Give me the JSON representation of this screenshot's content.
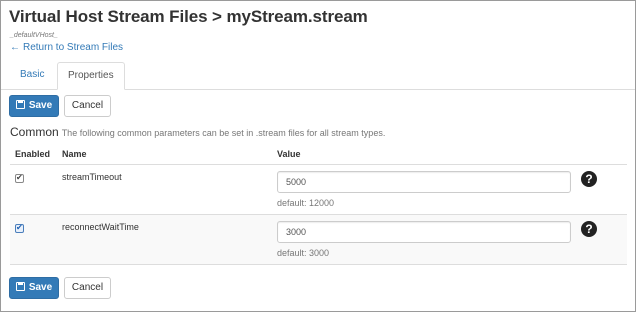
{
  "page": {
    "title": "Virtual Host Stream Files > myStream.stream",
    "vhost": "_defaultVHost_",
    "back_link": "Return to Stream Files",
    "back_icon": "←"
  },
  "tabs": [
    {
      "label": "Basic",
      "active": false
    },
    {
      "label": "Properties",
      "active": true
    }
  ],
  "actions": {
    "save_label": "Save",
    "cancel_label": "Cancel"
  },
  "section": {
    "heading": "Common",
    "description": "The following common parameters can be set in .stream files for all stream types."
  },
  "table": {
    "headers": {
      "enabled": "Enabled",
      "name": "Name",
      "value": "Value"
    },
    "rows": [
      {
        "enabled": true,
        "name": "streamTimeout",
        "value": "5000",
        "default": "default: 12000",
        "help_icon": "question-circle-icon"
      },
      {
        "enabled": true,
        "name": "reconnectWaitTime",
        "value": "3000",
        "default": "default: 3000",
        "help_icon": "question-circle-icon"
      }
    ]
  },
  "colors": {
    "primary": "#337ab7",
    "link": "#337ab7",
    "row_alt": "#f9f9f9",
    "border": "#dddddd"
  }
}
